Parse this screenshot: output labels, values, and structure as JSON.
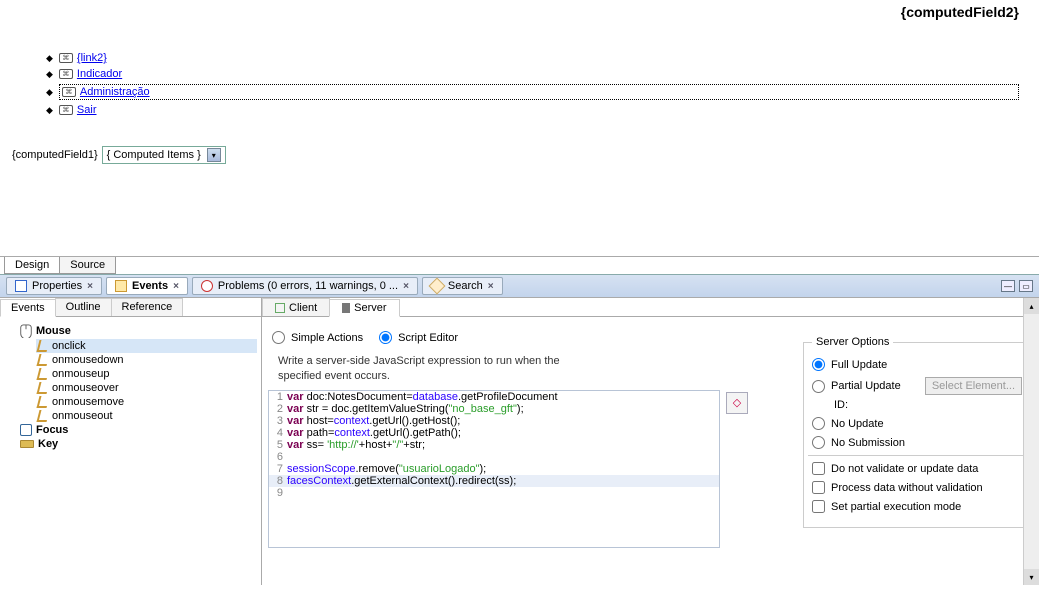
{
  "header": {
    "computedField2": "{computedField2}"
  },
  "nav": {
    "items": [
      {
        "label": "{link2}"
      },
      {
        "label": "Indicador"
      },
      {
        "label": "Administração",
        "selected": true
      },
      {
        "label": "Sair"
      }
    ]
  },
  "fieldRow": {
    "label": "{computedField1}",
    "combo": "{ Computed Items }"
  },
  "dsTabs": [
    "Design",
    "Source"
  ],
  "viewTabs": {
    "properties": "Properties",
    "events": "Events",
    "problems": "Problems (0 errors, 11 warnings, 0 ...",
    "search": "Search"
  },
  "leftTabs": [
    "Events",
    "Outline",
    "Reference"
  ],
  "eventTree": {
    "mouse": "Mouse",
    "items": [
      "onclick",
      "onmousedown",
      "onmouseup",
      "onmouseover",
      "onmousemove",
      "onmouseout"
    ],
    "focus": "Focus",
    "key": "Key"
  },
  "csTabs": {
    "client": "Client",
    "server": "Server"
  },
  "modes": {
    "simple": "Simple Actions",
    "script": "Script Editor"
  },
  "helpText": "Write a server-side JavaScript expression to run when the specified event occurs.",
  "code": {
    "lines": [
      {
        "n": 1,
        "pre": "var ",
        "a": "doc:NotesDocument=",
        "obj": "database",
        "post": ".getProfileDocument"
      },
      {
        "n": 2,
        "pre": "var ",
        "a": "str = doc.getItemValueString(",
        "str": "\"no_base_gft\"",
        "post": ");"
      },
      {
        "n": 3,
        "pre": "var ",
        "a": "host=",
        "obj": "context",
        "post": ".getUrl().getHost();"
      },
      {
        "n": 4,
        "pre": "var ",
        "a": "path=",
        "obj": "context",
        "post": ".getUrl().getPath();"
      },
      {
        "n": 5,
        "pre": "var ",
        "a": "ss= ",
        "str": "'http://'",
        "mid": "+host+",
        "str2": "\"/\"",
        "post": "+str;"
      },
      {
        "n": 6,
        "plain": ""
      },
      {
        "n": 7,
        "obj": "sessionScope",
        "post": ".remove(",
        "str": "\"usuarioLogado\"",
        "tail": ");"
      },
      {
        "n": 8,
        "obj": "facesContext",
        "post": ".getExternalContext().redirect(ss);",
        "hl": true
      },
      {
        "n": 9,
        "plain": ""
      }
    ]
  },
  "serverOptions": {
    "legend": "Server Options",
    "full": "Full Update",
    "partial": "Partial Update",
    "selectEl": "Select Element...",
    "idLabel": "ID:",
    "noUpdate": "No Update",
    "noSub": "No Submission",
    "noValidate": "Do not validate or update data",
    "procNoVal": "Process data without validation",
    "partialExec": "Set partial execution mode"
  }
}
